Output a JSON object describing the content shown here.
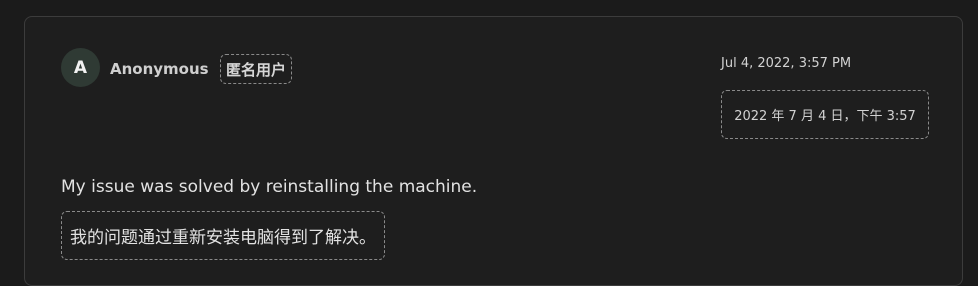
{
  "comment": {
    "author": {
      "initial": "A",
      "name": "Anonymous",
      "name_translation": "匿名用户"
    },
    "timestamp": "Jul 4, 2022, 3:57 PM",
    "timestamp_translation": "2022 年 7 月 4 日，下午 3:57",
    "message": "My issue was solved by reinstalling the machine.",
    "message_translation": "我的问题通过重新安装电脑得到了解决。"
  },
  "colors": {
    "background": "#1b1b1b",
    "card": "#1e1e1e",
    "avatar": "#2f3a34",
    "dashed_border": "#8a8a8a"
  }
}
